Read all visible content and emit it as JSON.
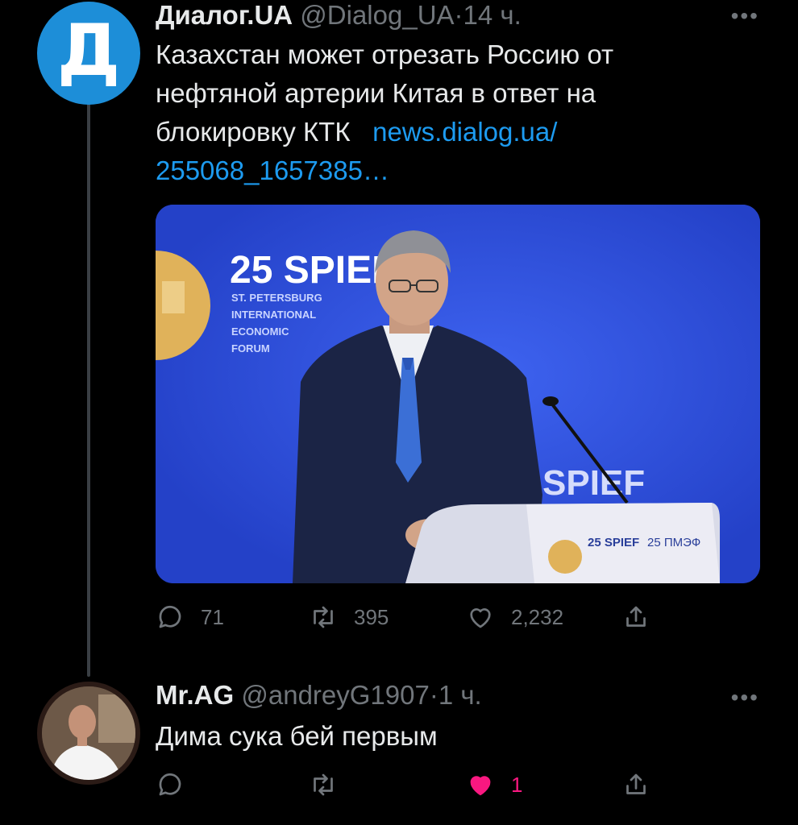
{
  "tweet1": {
    "avatar_letter": "Д",
    "name": "Диалог.UA",
    "handle": "@Dialog_UA",
    "separator": "·",
    "time": "14 ч.",
    "text_lines": [
      "Казахстан может отрезать Россию от",
      "нефтяной артерии Китая в ответ на",
      "блокировку КТК"
    ],
    "link_part1": "news.dialog.ua/",
    "link_part2": "255068_1657385…",
    "image_texts": {
      "spief_big": "25 SPIEF",
      "forum_line1": "ST. PETERSBURG",
      "forum_line2": "INTERNATIONAL",
      "forum_line3": "ECONOMIC",
      "forum_line4": "FORUM",
      "podium_spief": "25 SPIEF",
      "podium_pmef": "25 ПМЭФ",
      "backdrop_spief": "SPIEF"
    },
    "stats": {
      "replies": "71",
      "retweets": "395",
      "likes": "2,232"
    },
    "more_icon": "ellipsis-icon"
  },
  "tweet2": {
    "name": "Mr.AG",
    "handle": "@andreyG1907",
    "separator": "·",
    "time": "1 ч.",
    "text": "Дима сука бей первым",
    "stats": {
      "likes": "1"
    },
    "more_icon": "ellipsis-icon"
  },
  "colors": {
    "background": "#000000",
    "text": "#e7e9ea",
    "muted": "#71767b",
    "link": "#1d9bf0",
    "like": "#f91880",
    "avatar_blue": "#1d8ed8"
  }
}
